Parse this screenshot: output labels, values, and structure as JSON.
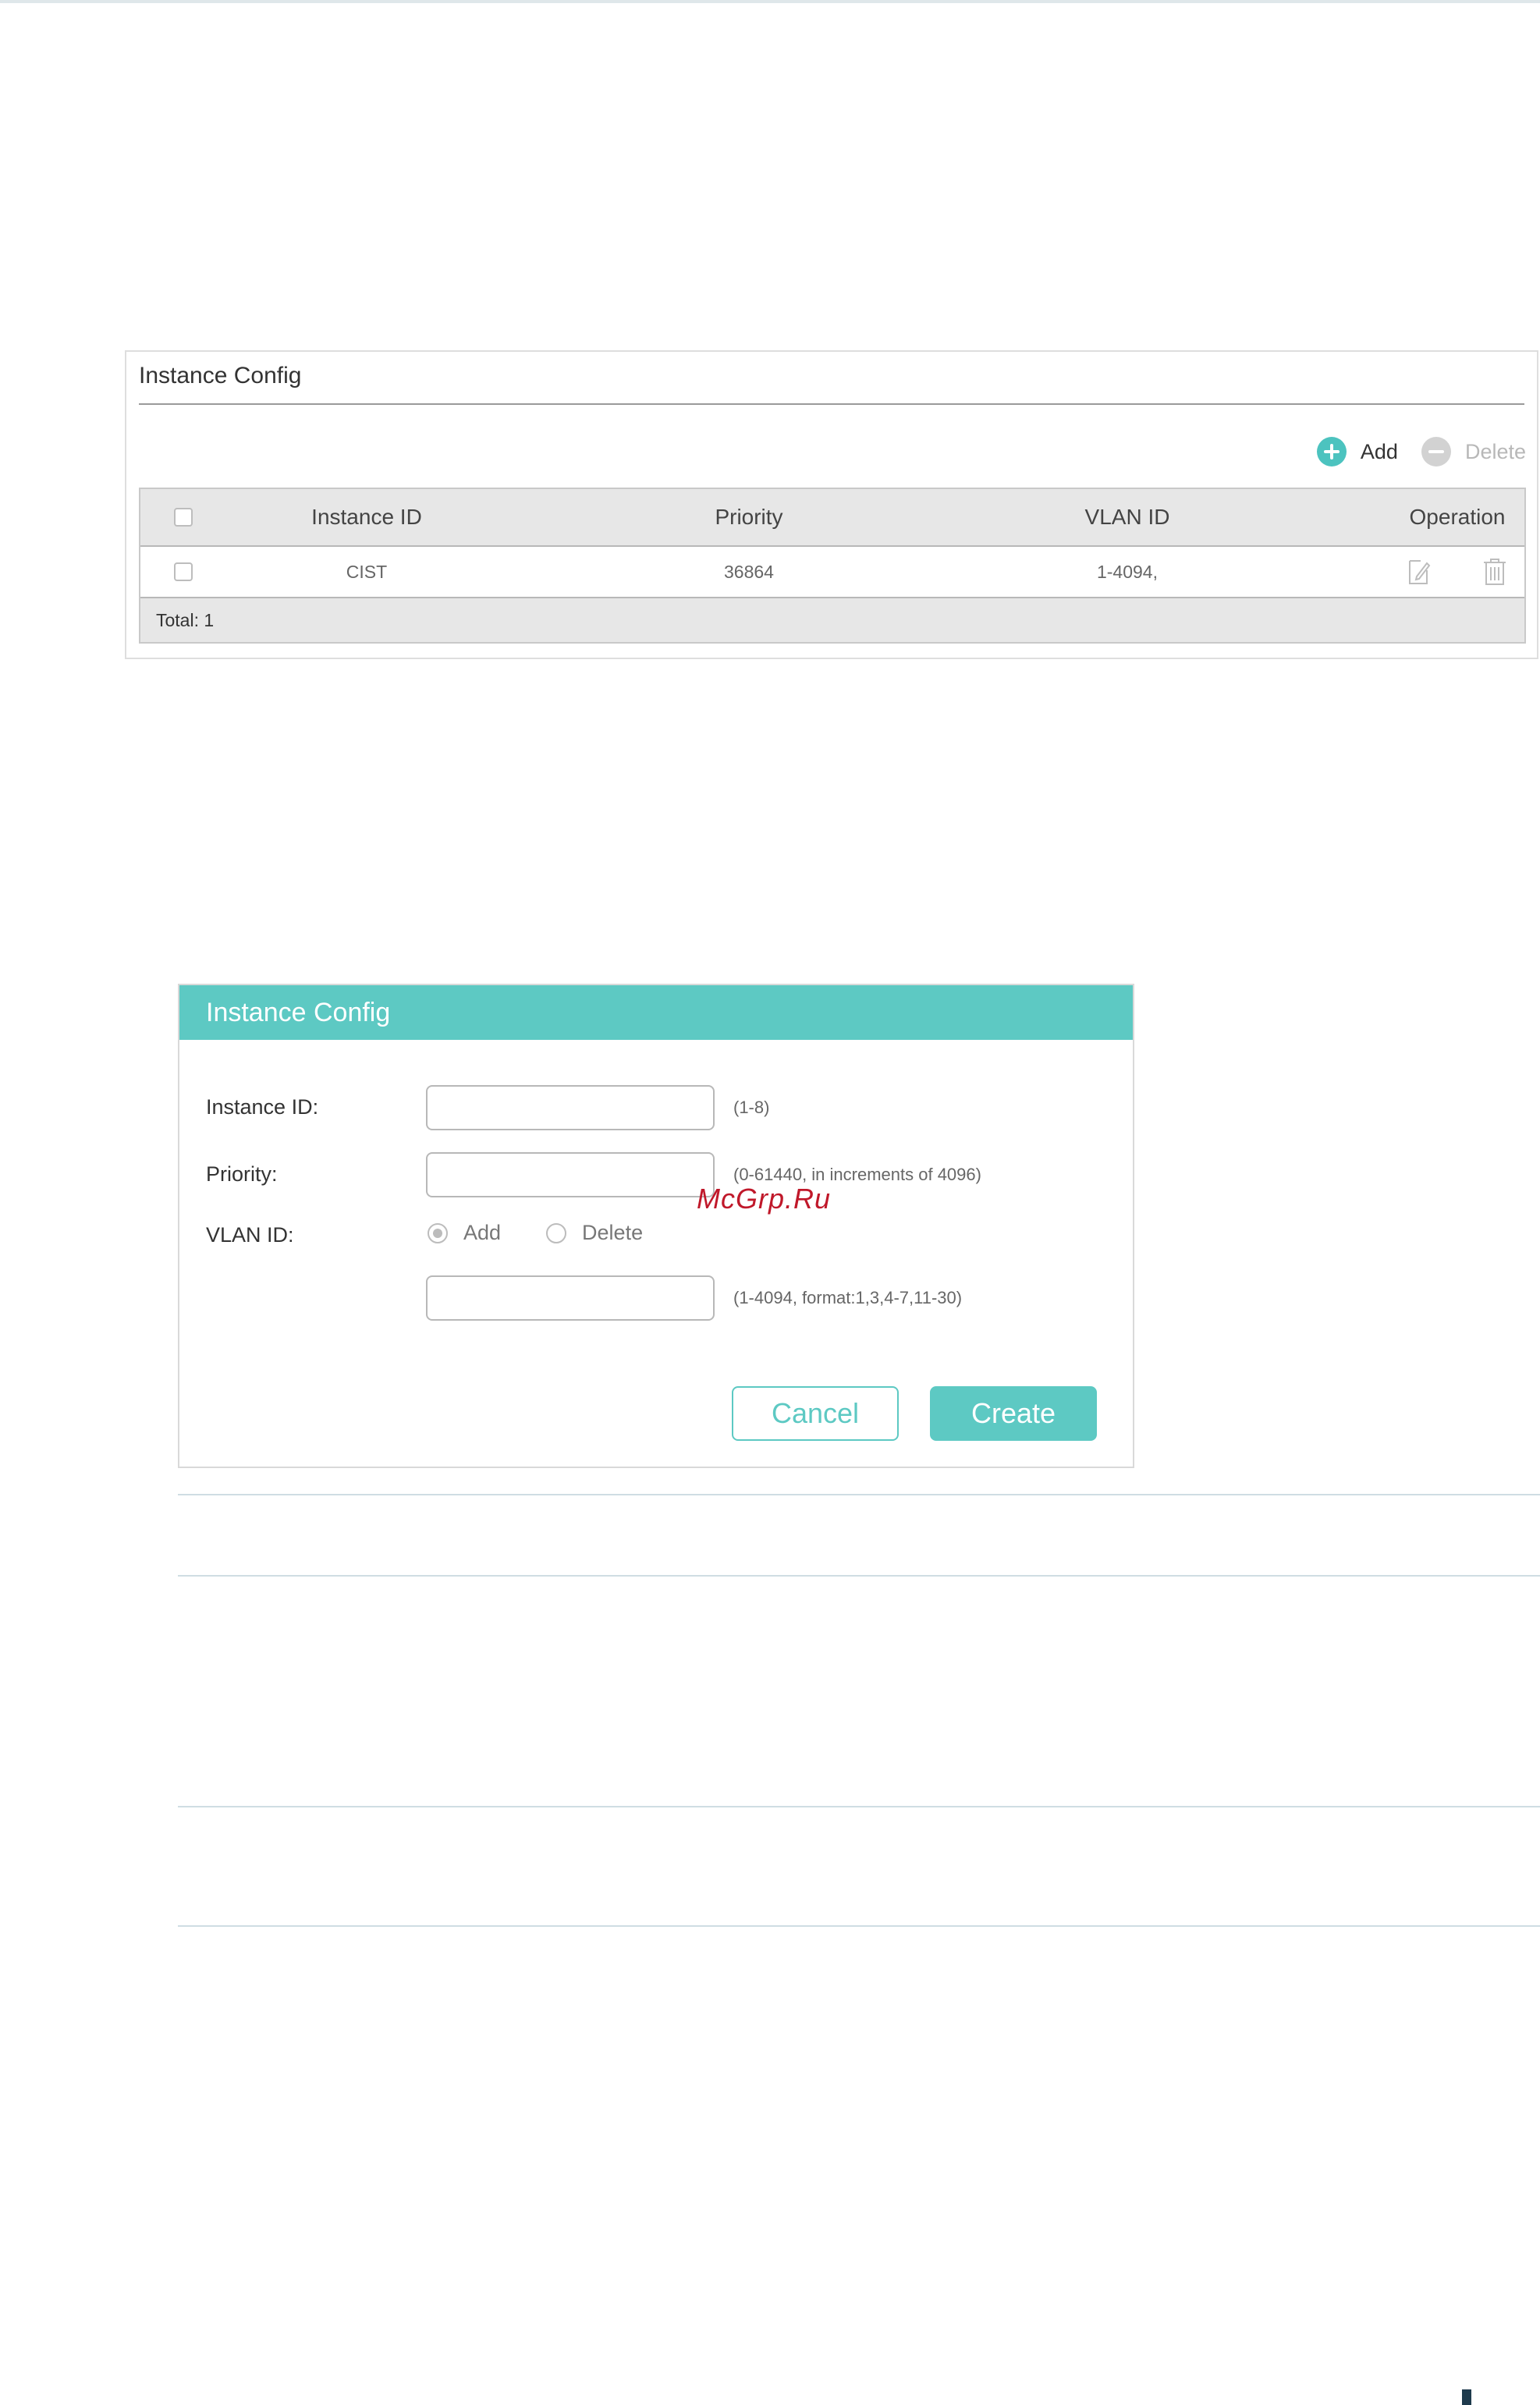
{
  "table_panel": {
    "title": "Instance Config",
    "toolbar": {
      "add_label": "Add",
      "delete_label": "Delete"
    },
    "columns": [
      "",
      "Instance ID",
      "Priority",
      "VLAN ID",
      "Operation"
    ],
    "rows": [
      {
        "instance_id": "CIST",
        "priority": "36864",
        "vlan_id": "1-4094,"
      }
    ],
    "total": "Total: 1"
  },
  "dialog": {
    "title": "Instance Config",
    "instance_id": {
      "label": "Instance ID:",
      "value": "",
      "hint": "(1-8)"
    },
    "priority": {
      "label": "Priority:",
      "value": "",
      "hint": "(0-61440, in increments of 4096)"
    },
    "vlan_id": {
      "label": "VLAN ID:",
      "options": [
        "Add",
        "Delete"
      ],
      "selected": "Add",
      "value": "",
      "hint": "(1-4094, format:1,3,4-7,11-30)"
    },
    "cancel_label": "Cancel",
    "create_label": "Create"
  },
  "watermark": "McGrp.Ru",
  "colors": {
    "accent": "#5dc9c3",
    "add_icon": "#4cc3bf",
    "watermark": "#c0182a"
  },
  "icons": [
    "add-icon",
    "delete-icon",
    "edit-icon",
    "trash-icon"
  ]
}
